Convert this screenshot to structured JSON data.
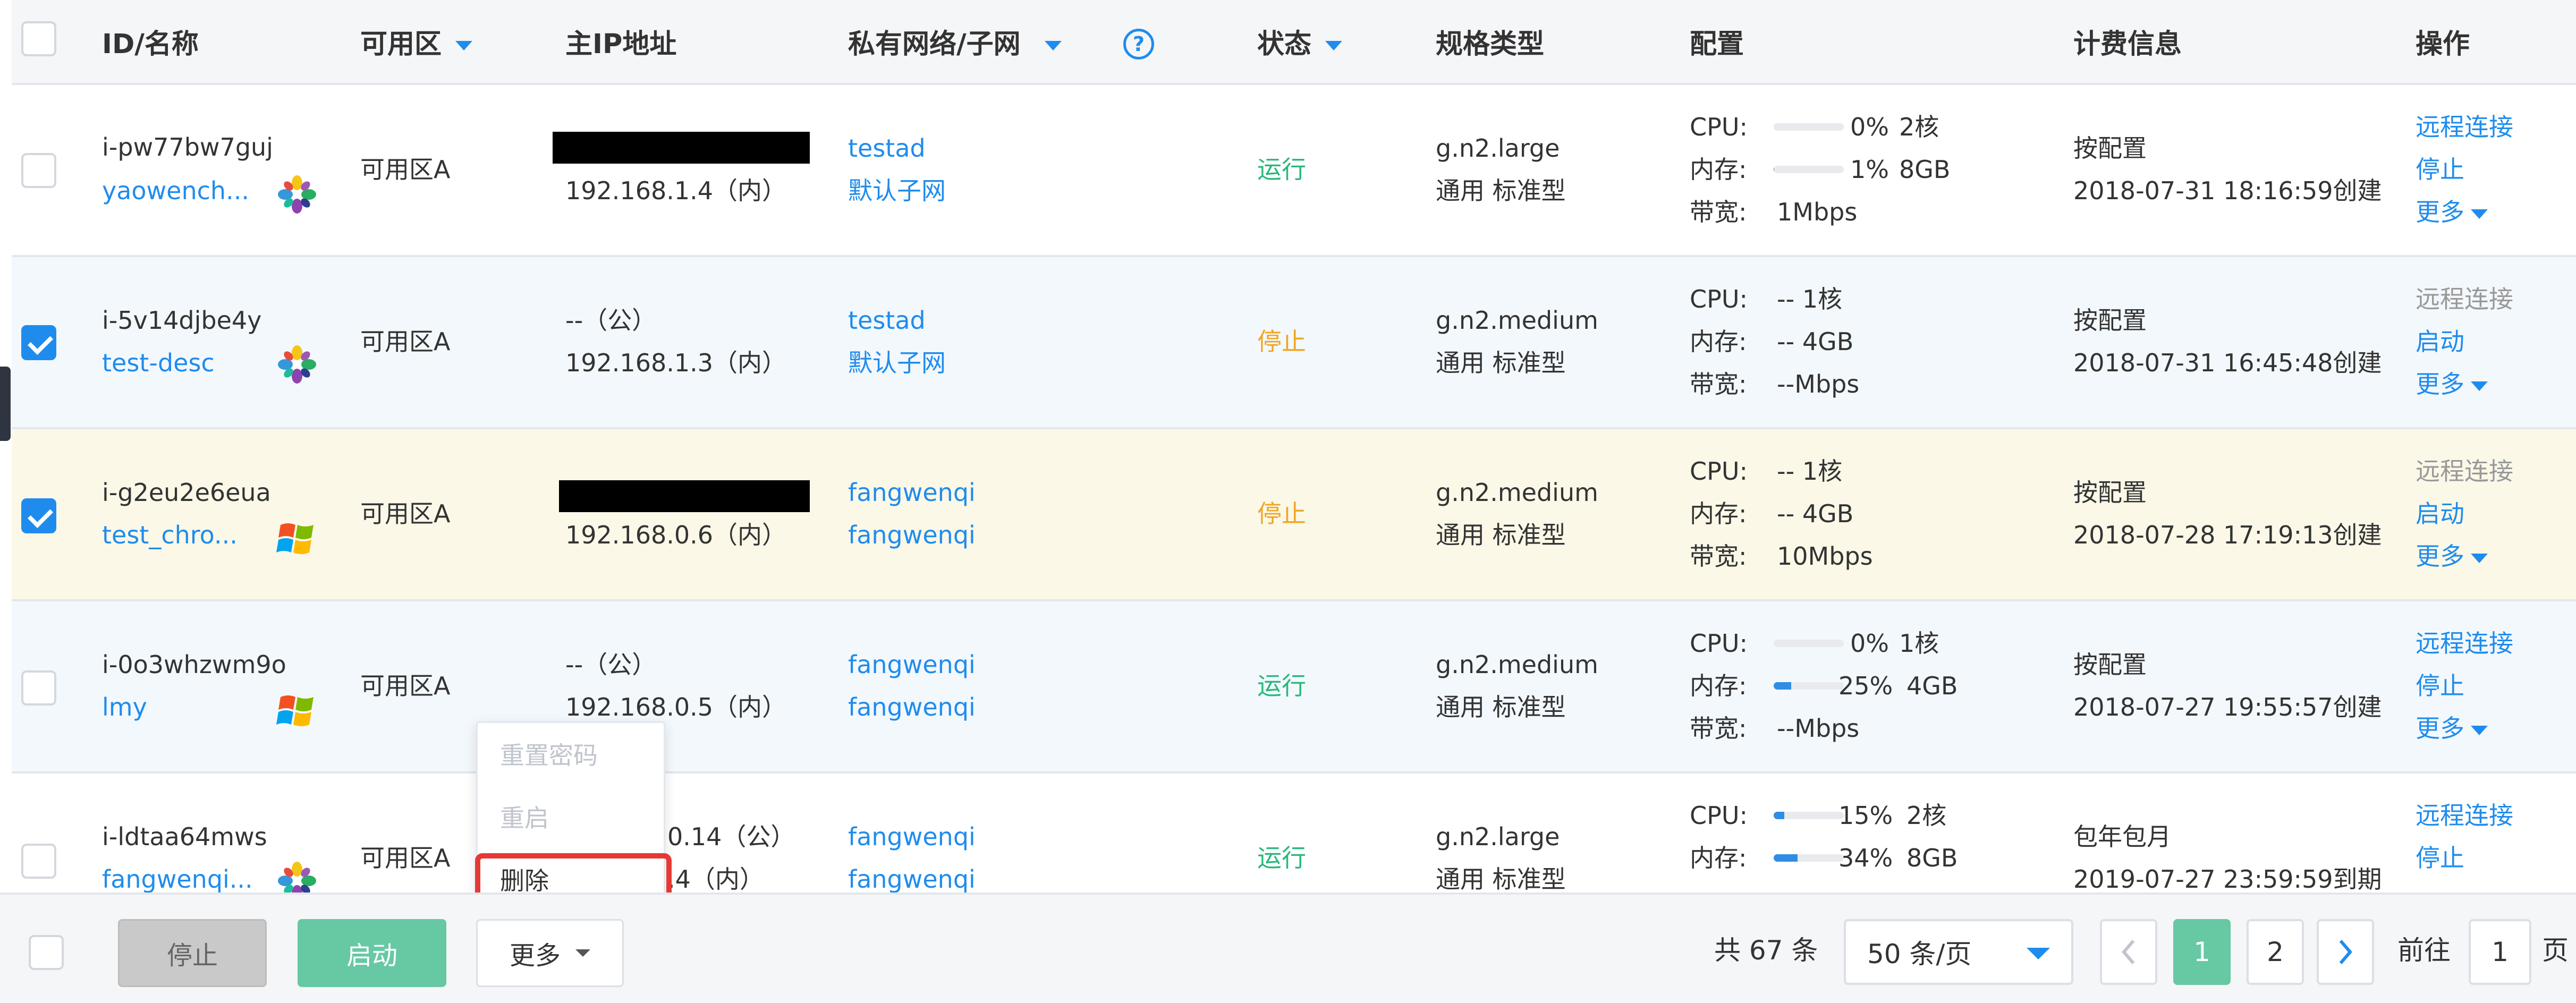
{
  "header": {
    "id_name": "ID/名称",
    "zone": "可用区",
    "main_ip": "主IP地址",
    "private_net": "私有网络/子网",
    "status": "状态",
    "spec_type": "规格类型",
    "config": "配置",
    "billing": "计费信息",
    "actions": "操作"
  },
  "labels": {
    "cpu": "CPU:",
    "mem": "内存:",
    "bw": "带宽:",
    "remote": "远程连接",
    "stop": "停止",
    "start": "启动",
    "more": "更多"
  },
  "rows": [
    {
      "id": "i-pw77bw7guj",
      "name": "yaowench...",
      "os": "generic",
      "zone": "可用区A",
      "ip1": "",
      "ip1_redacted": true,
      "ip2": "192.168.1.4（内）",
      "net": "testad",
      "subnet": "默认子网",
      "status": "运行",
      "spec": "g.n2.large",
      "spec_family": "通用 标准型",
      "cpu_pct": "0%",
      "cpu_pct_value": 0,
      "cpu_cores": "2核",
      "mem_pct": "1%",
      "mem_pct_value": 1,
      "mem_size": "8GB",
      "bw": "1Mbps",
      "bill_type": "按配置",
      "bill_time": "2018-07-31 18:16:59创建",
      "action1": "远程连接",
      "action2": "停止",
      "selected": false
    },
    {
      "id": "i-5v14djbe4y",
      "name": "test-desc",
      "os": "generic",
      "zone": "可用区A",
      "ip1": "--（公）",
      "ip1_redacted": false,
      "ip2": "192.168.1.3（内）",
      "net": "testad",
      "subnet": "默认子网",
      "status": "停止",
      "spec": "g.n2.medium",
      "spec_family": "通用 标准型",
      "cpu_text": "-- 1核",
      "mem_text": "-- 4GB",
      "bw": "--Mbps",
      "bill_type": "按配置",
      "bill_time": "2018-07-31 16:45:48创建",
      "action1": "远程连接",
      "action2": "启动",
      "selected": true
    },
    {
      "id": "i-g2eu2e6eua",
      "name": "test_chro...",
      "os": "windows",
      "zone": "可用区A",
      "ip1": "",
      "ip1_redacted": true,
      "ip2": "192.168.0.6（内）",
      "net": "fangwenqi",
      "subnet": "fangwenqi",
      "status": "停止",
      "spec": "g.n2.medium",
      "spec_family": "通用 标准型",
      "cpu_text": "-- 1核",
      "mem_text": "-- 4GB",
      "bw": "10Mbps",
      "bill_type": "按配置",
      "bill_time": "2018-07-28 17:19:13创建",
      "action1": "远程连接",
      "action2": "启动",
      "selected": true
    },
    {
      "id": "i-0o3whzwm9o",
      "name": "lmy",
      "os": "windows",
      "zone": "可用区A",
      "ip1": "--（公）",
      "ip1_redacted": false,
      "ip2": "192.168.0.5（内）",
      "net": "fangwenqi",
      "subnet": "fangwenqi",
      "status": "运行",
      "spec": "g.n2.medium",
      "spec_family": "通用 标准型",
      "cpu_pct": "0%",
      "cpu_pct_value": 0,
      "cpu_cores": "1核",
      "mem_pct": "25%",
      "mem_pct_value": 25,
      "mem_size": "4GB",
      "bw": "--Mbps",
      "bill_type": "按配置",
      "bill_time": "2018-07-27 19:55:57创建",
      "action1": "远程连接",
      "action2": "停止",
      "selected": false
    },
    {
      "id": "i-ldtaa64mws",
      "name": "fangwenqi...",
      "os": "generic",
      "zone": "可用区A",
      "ip1": "0.14（公）",
      "ip2": ".4（内）",
      "net": "fangwenqi",
      "subnet": "fangwenqi",
      "status": "运行",
      "spec": "g.n2.large",
      "spec_family": "通用 标准型",
      "cpu_pct": "15%",
      "cpu_pct_value": 15,
      "cpu_cores": "2核",
      "mem_pct": "34%",
      "mem_pct_value": 34,
      "mem_size": "8GB",
      "bill_type": "包年包月",
      "bill_time": "2019-07-27 23:59:59到期",
      "action1": "远程连接",
      "action2": "停止",
      "selected": false
    }
  ],
  "dropdown": {
    "items": [
      "重置密码",
      "重启",
      "删除"
    ],
    "disabled": [
      true,
      true,
      false
    ],
    "highlighted": "删除"
  },
  "footer": {
    "stop_label": "停止",
    "start_label": "启动",
    "more_label": "更多",
    "total": "共 67 条",
    "page_size": "50 条/页",
    "pages": [
      "1",
      "2"
    ],
    "current_page": "1",
    "goto_label": "前往",
    "goto_value": "1",
    "page_unit": "页"
  },
  "colors": {
    "link": "#1f8ced",
    "running": "#29b87a",
    "stopped": "#f0a623",
    "start_button": "#67c8a4",
    "highlight_box": "#e53935"
  }
}
